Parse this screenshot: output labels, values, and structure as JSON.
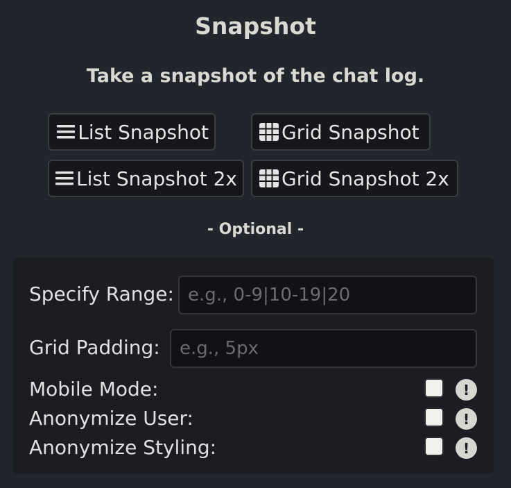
{
  "header": {
    "title": "Snapshot",
    "subtitle": "Take a snapshot of the chat log."
  },
  "buttons": {
    "list_snapshot": {
      "label": "List Snapshot",
      "icon": "list-icon"
    },
    "grid_snapshot": {
      "label": "Grid Snapshot",
      "icon": "grid-icon"
    },
    "list_snapshot_2x": {
      "label": "List Snapshot 2x",
      "icon": "list-icon"
    },
    "grid_snapshot_2x": {
      "label": "Grid Snapshot 2x",
      "icon": "grid-icon"
    }
  },
  "optional_heading": "- Optional -",
  "options": {
    "range": {
      "label": "Specify Range:",
      "placeholder": "e.g., 0-9|10-19|20",
      "value": ""
    },
    "padding": {
      "label": "Grid Padding:",
      "placeholder": "e.g., 5px",
      "value": ""
    },
    "mobile_mode": {
      "label": "Mobile Mode:",
      "checked": false,
      "info": "!"
    },
    "anonymize_user": {
      "label": "Anonymize User:",
      "checked": false,
      "info": "!"
    },
    "anonymize_styling": {
      "label": "Anonymize Styling:",
      "checked": false,
      "info": "!"
    }
  },
  "colors": {
    "background": "#22252c",
    "panel": "#1b1d22",
    "button_bg": "#16171b",
    "text": "#e0e0e0"
  }
}
